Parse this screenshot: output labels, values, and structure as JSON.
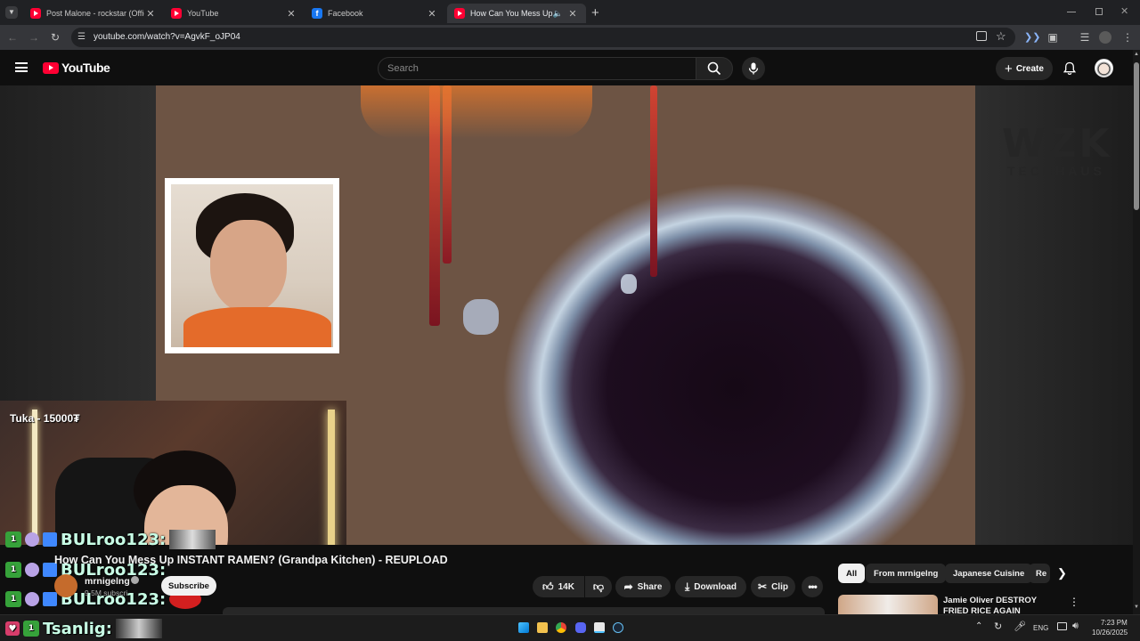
{
  "browser": {
    "tabs": [
      {
        "title": "Post Malone - rockstar (Official",
        "icon": "youtube-icon"
      },
      {
        "title": "YouTube",
        "icon": "youtube-icon"
      },
      {
        "title": "Facebook",
        "icon": "facebook-icon"
      },
      {
        "title": "How Can You Mess Up INST",
        "icon": "youtube-icon",
        "active": true,
        "audio": true
      }
    ],
    "url": "youtube.com/watch?v=AgvkF_oJP04"
  },
  "youtube": {
    "logo_text": "YouTube",
    "search_placeholder": "Search",
    "create_label": "Create"
  },
  "video": {
    "watermark_top": "WZK",
    "watermark_bottom": "TECHHAUS",
    "donation_text": "Tuka - 15000₮"
  },
  "chat": [
    {
      "user": "BULroo123:"
    },
    {
      "user": "BULroo123:"
    },
    {
      "user": "BULroo123:"
    },
    {
      "user": "Tsanlig:"
    }
  ],
  "watch": {
    "title": "How Can You Mess Up INSTANT RAMEN? (Grandpa Kitchen) - REUPLOAD",
    "channel": "mrnigelng",
    "subscribers": "9.5M subscri",
    "subscribe_label": "Subscribe",
    "likes": "14K",
    "share_label": "Share",
    "download_label": "Download",
    "clip_label": "Clip"
  },
  "sidebar": {
    "chips": [
      "All",
      "From mrnigelng",
      "Japanese Cuisine",
      "Re"
    ],
    "recommendation_title": "Jamie Oliver DESTROY FRIED RICE AGAIN"
  },
  "taskbar": {
    "language": "ENG",
    "time": "7:23 PM",
    "date": "10/26/2025"
  },
  "colors": {
    "youtube_red": "#ff0033",
    "background": "#0f0f0f",
    "chip_active": "#f1f1f1"
  }
}
